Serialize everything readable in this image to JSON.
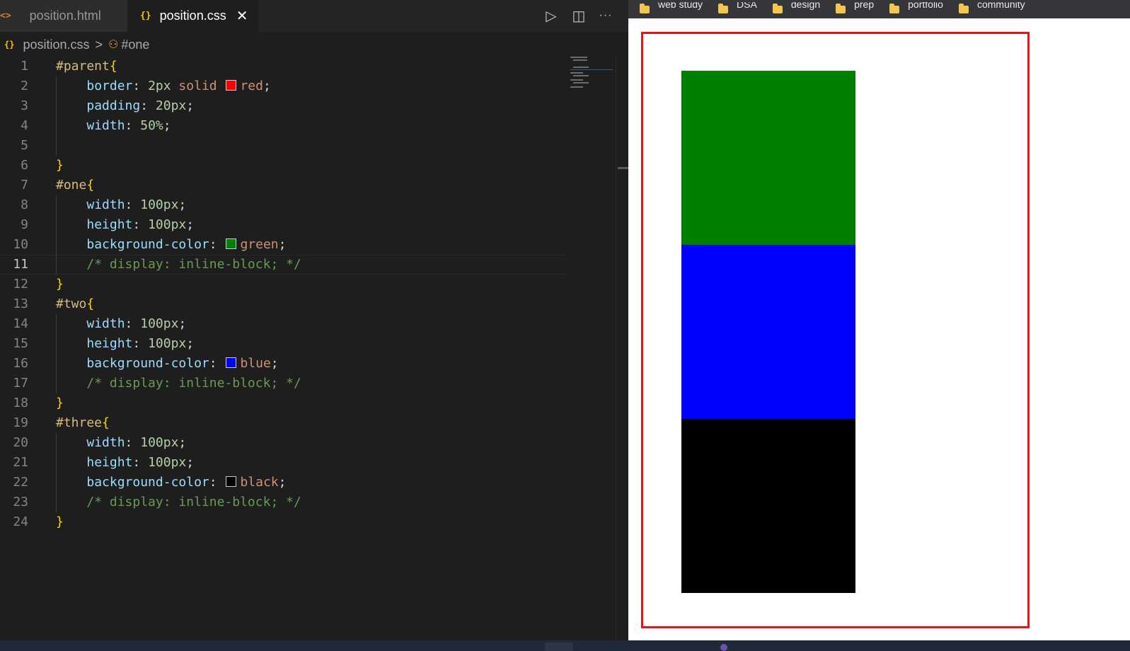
{
  "tabs": [
    {
      "icon": "html-file-icon",
      "glyph": "<>",
      "label": "position.html",
      "active": false
    },
    {
      "icon": "css-file-icon",
      "glyph": "{}",
      "label": "position.css",
      "active": true
    }
  ],
  "toolbar": {
    "run_glyph": "▷",
    "split_glyph": "◫",
    "more_glyph": "···",
    "close_glyph": "✕"
  },
  "breadcrumb": {
    "file": "position.css",
    "separator": ">",
    "symbol": "#one"
  },
  "current_line": 11,
  "code_lines": [
    {
      "n": "1",
      "tokens": [
        {
          "t": "#parent",
          "c": "sel"
        },
        {
          "t": "{",
          "c": "brace"
        }
      ]
    },
    {
      "n": "2",
      "tokens": [
        {
          "t": "    ",
          "c": "punc"
        },
        {
          "t": "border",
          "c": "prop"
        },
        {
          "t": ": ",
          "c": "punc"
        },
        {
          "t": "2px",
          "c": "num"
        },
        {
          "t": " solid ",
          "c": "kw"
        },
        {
          "sw": "#ff0000"
        },
        {
          "t": "red",
          "c": "kw"
        },
        {
          "t": ";",
          "c": "punc"
        }
      ]
    },
    {
      "n": "3",
      "tokens": [
        {
          "t": "    ",
          "c": "punc"
        },
        {
          "t": "padding",
          "c": "prop"
        },
        {
          "t": ": ",
          "c": "punc"
        },
        {
          "t": "20px",
          "c": "num"
        },
        {
          "t": ";",
          "c": "punc"
        }
      ]
    },
    {
      "n": "4",
      "tokens": [
        {
          "t": "    ",
          "c": "punc"
        },
        {
          "t": "width",
          "c": "prop"
        },
        {
          "t": ": ",
          "c": "punc"
        },
        {
          "t": "50%",
          "c": "num"
        },
        {
          "t": ";",
          "c": "punc"
        }
      ]
    },
    {
      "n": "5",
      "tokens": []
    },
    {
      "n": "6",
      "tokens": [
        {
          "t": "}",
          "c": "brace"
        }
      ]
    },
    {
      "n": "7",
      "tokens": [
        {
          "t": "#one",
          "c": "sel"
        },
        {
          "t": "{",
          "c": "brace"
        }
      ]
    },
    {
      "n": "8",
      "tokens": [
        {
          "t": "    ",
          "c": "punc"
        },
        {
          "t": "width",
          "c": "prop"
        },
        {
          "t": ": ",
          "c": "punc"
        },
        {
          "t": "100px",
          "c": "num"
        },
        {
          "t": ";",
          "c": "punc"
        }
      ]
    },
    {
      "n": "9",
      "tokens": [
        {
          "t": "    ",
          "c": "punc"
        },
        {
          "t": "height",
          "c": "prop"
        },
        {
          "t": ": ",
          "c": "punc"
        },
        {
          "t": "100px",
          "c": "num"
        },
        {
          "t": ";",
          "c": "punc"
        }
      ]
    },
    {
      "n": "10",
      "tokens": [
        {
          "t": "    ",
          "c": "punc"
        },
        {
          "t": "background-color",
          "c": "prop"
        },
        {
          "t": ": ",
          "c": "punc"
        },
        {
          "sw": "#008000"
        },
        {
          "t": "green",
          "c": "kw"
        },
        {
          "t": ";",
          "c": "punc"
        }
      ]
    },
    {
      "n": "11",
      "tokens": [
        {
          "t": "    ",
          "c": "punc"
        },
        {
          "t": "/* display: inline-block; */",
          "c": "cmt"
        }
      ]
    },
    {
      "n": "12",
      "tokens": [
        {
          "t": "}",
          "c": "brace"
        }
      ]
    },
    {
      "n": "13",
      "tokens": [
        {
          "t": "#two",
          "c": "sel"
        },
        {
          "t": "{",
          "c": "brace"
        }
      ]
    },
    {
      "n": "14",
      "tokens": [
        {
          "t": "    ",
          "c": "punc"
        },
        {
          "t": "width",
          "c": "prop"
        },
        {
          "t": ": ",
          "c": "punc"
        },
        {
          "t": "100px",
          "c": "num"
        },
        {
          "t": ";",
          "c": "punc"
        }
      ]
    },
    {
      "n": "15",
      "tokens": [
        {
          "t": "    ",
          "c": "punc"
        },
        {
          "t": "height",
          "c": "prop"
        },
        {
          "t": ": ",
          "c": "punc"
        },
        {
          "t": "100px",
          "c": "num"
        },
        {
          "t": ";",
          "c": "punc"
        }
      ]
    },
    {
      "n": "16",
      "tokens": [
        {
          "t": "    ",
          "c": "punc"
        },
        {
          "t": "background-color",
          "c": "prop"
        },
        {
          "t": ": ",
          "c": "punc"
        },
        {
          "sw": "#0000ff"
        },
        {
          "t": "blue",
          "c": "kw"
        },
        {
          "t": ";",
          "c": "punc"
        }
      ]
    },
    {
      "n": "17",
      "tokens": [
        {
          "t": "    ",
          "c": "punc"
        },
        {
          "t": "/* display: inline-block; */",
          "c": "cmt"
        }
      ]
    },
    {
      "n": "18",
      "tokens": [
        {
          "t": "}",
          "c": "brace"
        }
      ]
    },
    {
      "n": "19",
      "tokens": [
        {
          "t": "#three",
          "c": "sel"
        },
        {
          "t": "{",
          "c": "brace"
        }
      ]
    },
    {
      "n": "20",
      "tokens": [
        {
          "t": "    ",
          "c": "punc"
        },
        {
          "t": "width",
          "c": "prop"
        },
        {
          "t": ": ",
          "c": "punc"
        },
        {
          "t": "100px",
          "c": "num"
        },
        {
          "t": ";",
          "c": "punc"
        }
      ]
    },
    {
      "n": "21",
      "tokens": [
        {
          "t": "    ",
          "c": "punc"
        },
        {
          "t": "height",
          "c": "prop"
        },
        {
          "t": ": ",
          "c": "punc"
        },
        {
          "t": "100px",
          "c": "num"
        },
        {
          "t": ";",
          "c": "punc"
        }
      ]
    },
    {
      "n": "22",
      "tokens": [
        {
          "t": "    ",
          "c": "punc"
        },
        {
          "t": "background-color",
          "c": "prop"
        },
        {
          "t": ": ",
          "c": "punc"
        },
        {
          "sw": "#000000"
        },
        {
          "t": "black",
          "c": "kw"
        },
        {
          "t": ";",
          "c": "punc"
        }
      ]
    },
    {
      "n": "23",
      "tokens": [
        {
          "t": "    ",
          "c": "punc"
        },
        {
          "t": "/* display: inline-block; */",
          "c": "cmt"
        }
      ]
    },
    {
      "n": "24",
      "tokens": [
        {
          "t": "}",
          "c": "brace"
        }
      ]
    }
  ],
  "bookmarks": [
    "web study",
    "DSA",
    "design",
    "prep",
    "portfolio",
    "community"
  ],
  "preview": {
    "parent_border_color": "#ee1111",
    "boxes": [
      {
        "id": "one",
        "color": "#008000"
      },
      {
        "id": "two",
        "color": "#0000ff"
      },
      {
        "id": "three",
        "color": "#000000"
      }
    ]
  }
}
